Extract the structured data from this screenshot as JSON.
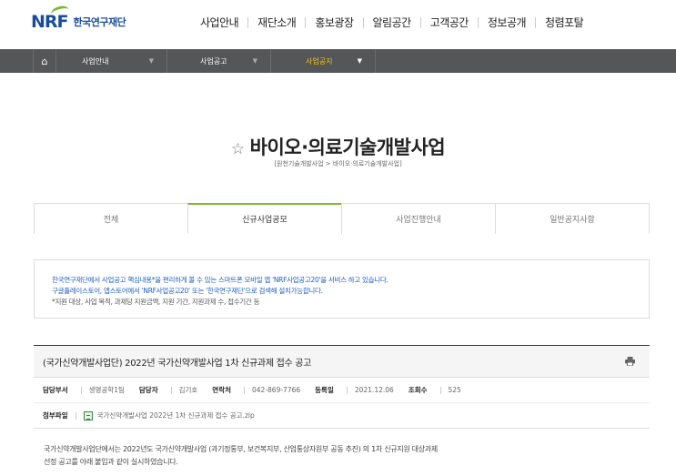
{
  "header": {
    "logo_mark": "NRF",
    "logo_text": "한국연구재단",
    "nav": [
      "사업안내",
      "재단소개",
      "홍보광장",
      "알림공간",
      "고객공간",
      "정보공개",
      "청렴포탈"
    ]
  },
  "location": {
    "home_icon": "home-icon",
    "items": [
      {
        "label": "사업안내",
        "active": false
      },
      {
        "label": "사업공고",
        "active": false
      },
      {
        "label": "사업공지",
        "active": true
      }
    ]
  },
  "page": {
    "title": "바이오·의료기술개발사업",
    "title_icon": "star-outline-icon",
    "subtitle": "[원천기술개발사업 > 바이오·의료기술개발사업]"
  },
  "tabs": [
    {
      "label": "전체",
      "active": false
    },
    {
      "label": "신규사업공모",
      "active": true
    },
    {
      "label": "사업진행안내",
      "active": false
    },
    {
      "label": "일반공지사항",
      "active": false
    }
  ],
  "notice": {
    "line1": "한국연구재단에서 사업공고 핵심내용*을 편리하게 볼 수 있는 스마트폰 모바일 앱 'NRF사업공고20'을 서비스 하고 있습니다.",
    "line2": "구글플레이스토어, 앱스토어에서 'NRF사업공고20' 또는 '한국연구재단'으로 검색해 설치가능합니다.",
    "line3": "*지원 대상, 사업 목적, 과제당 지원금액, 지원 기간, 지원과제 수, 접수기간 등"
  },
  "post": {
    "title": "(국가신약개발사업단) 2022년 국가신약개발사업 1차 신규과제 접수 공고",
    "print_icon": "print-icon",
    "meta": [
      {
        "key": "담당부서",
        "value": "생명공학1팀"
      },
      {
        "key": "담당자",
        "value": "김기호"
      },
      {
        "key": "연락처",
        "value": "042-869-7766"
      },
      {
        "key": "등록일",
        "value": "2021.12.06"
      },
      {
        "key": "조회수",
        "value": "525"
      }
    ],
    "attach_label": "첨부파일",
    "attach_file": "국가신약개발사업 2022년 1차 신규과제 접수 공고.zip",
    "body_line1": "국가신약개발사업단에서는 2022년도 국가신약개발사업 (과기정통부, 보건복지부, 산업통상자원부 공동 추진) 의 1차 신규지원 대상과제",
    "body_line2": "선정 공고를 아래 붙임과 같이 실시하였습니다."
  },
  "colors": {
    "brand_blue": "#1a4c9c",
    "brand_green": "#7dbb2d",
    "locbar_bg": "#555658",
    "active_yellow": "#f2c41e",
    "notice_blue": "#1f5ec2"
  }
}
